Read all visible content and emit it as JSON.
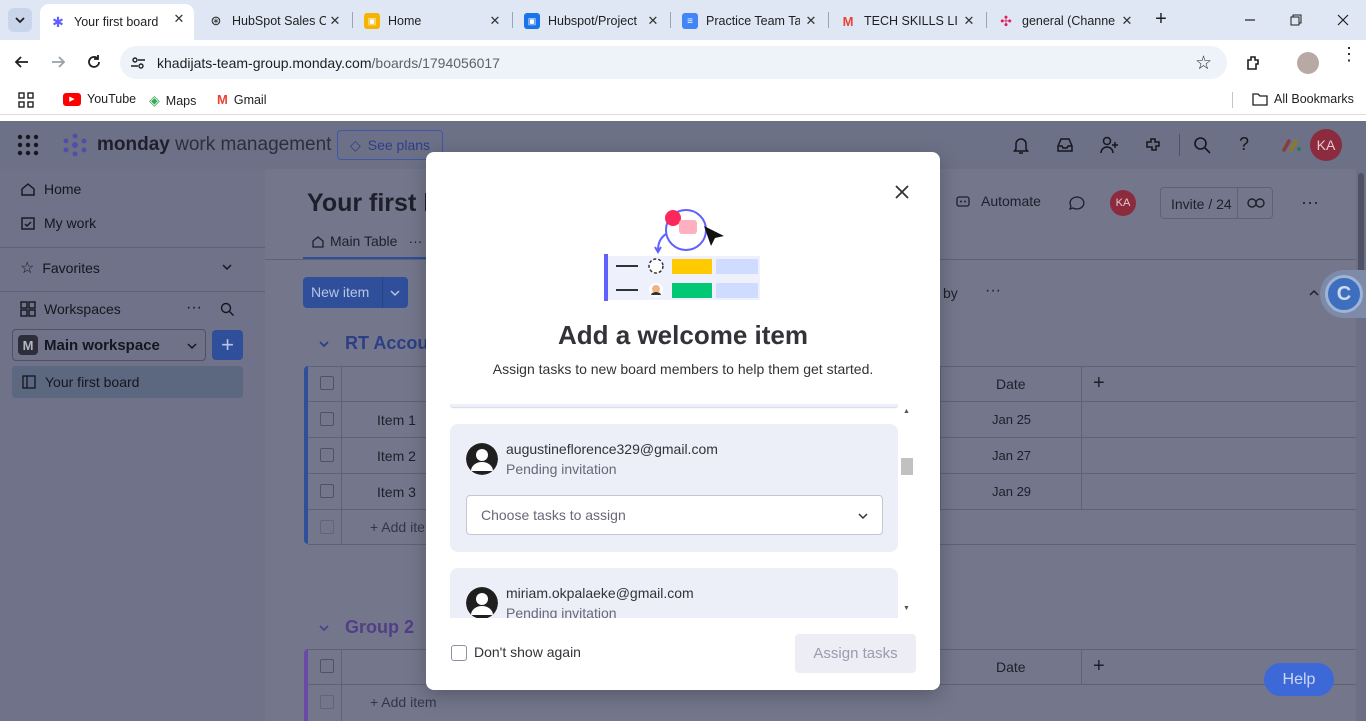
{
  "browser": {
    "tabs": [
      {
        "title": "Your first board",
        "active": true
      },
      {
        "title": "HubSpot Sales C"
      },
      {
        "title": "Home"
      },
      {
        "title": "Hubspot/Project"
      },
      {
        "title": "Practice Team Ta"
      },
      {
        "title": "TECH SKILLS LIN"
      },
      {
        "title": "general (Channe"
      }
    ],
    "url_host": "khadijats-team-group.monday.com",
    "url_path": "/boards/1794056017",
    "bookmarks": [
      "YouTube",
      "Maps",
      "Gmail"
    ],
    "all_bookmarks": "All Bookmarks"
  },
  "app": {
    "brand": "monday",
    "brand_suffix": "work management",
    "see_plans": "See plans",
    "avatar_initials": "KA",
    "sidebar": {
      "home": "Home",
      "my_work": "My work",
      "favorites": "Favorites",
      "workspaces": "Workspaces",
      "workspace_name": "Main workspace",
      "workspace_initial": "M",
      "board_item": "Your first board"
    },
    "board": {
      "title": "Your first b",
      "tab_main": "Main Table",
      "new_item": "New item",
      "automate": "Automate",
      "invite": "Invite / 24",
      "by_label": "by",
      "group1": "RT Accou",
      "group2": "Group 2",
      "date_header": "Date",
      "items": [
        {
          "name": "Item 1",
          "date": "Jan 25"
        },
        {
          "name": "Item 2",
          "date": "Jan 27"
        },
        {
          "name": "Item 3",
          "date": "Jan 29"
        }
      ],
      "add_item": "+ Add ite",
      "add_item2": "+ Add item"
    },
    "help": "Help"
  },
  "modal": {
    "title": "Add a welcome item",
    "subtitle": "Assign tasks to new board members to help them get started.",
    "members": [
      {
        "email": "augustineflorence329@gmail.com",
        "status": "Pending invitation",
        "select_placeholder": "Choose tasks to assign"
      },
      {
        "email": "miriam.okpalaeke@gmail.com",
        "status": "Pending invitation"
      }
    ],
    "dont_show": "Don't show again",
    "assign_button": "Assign tasks"
  },
  "colors": {
    "accent": "#0073ea",
    "brand_green": "#00c875",
    "yellow": "#ffcb00",
    "red": "#e2445c"
  }
}
